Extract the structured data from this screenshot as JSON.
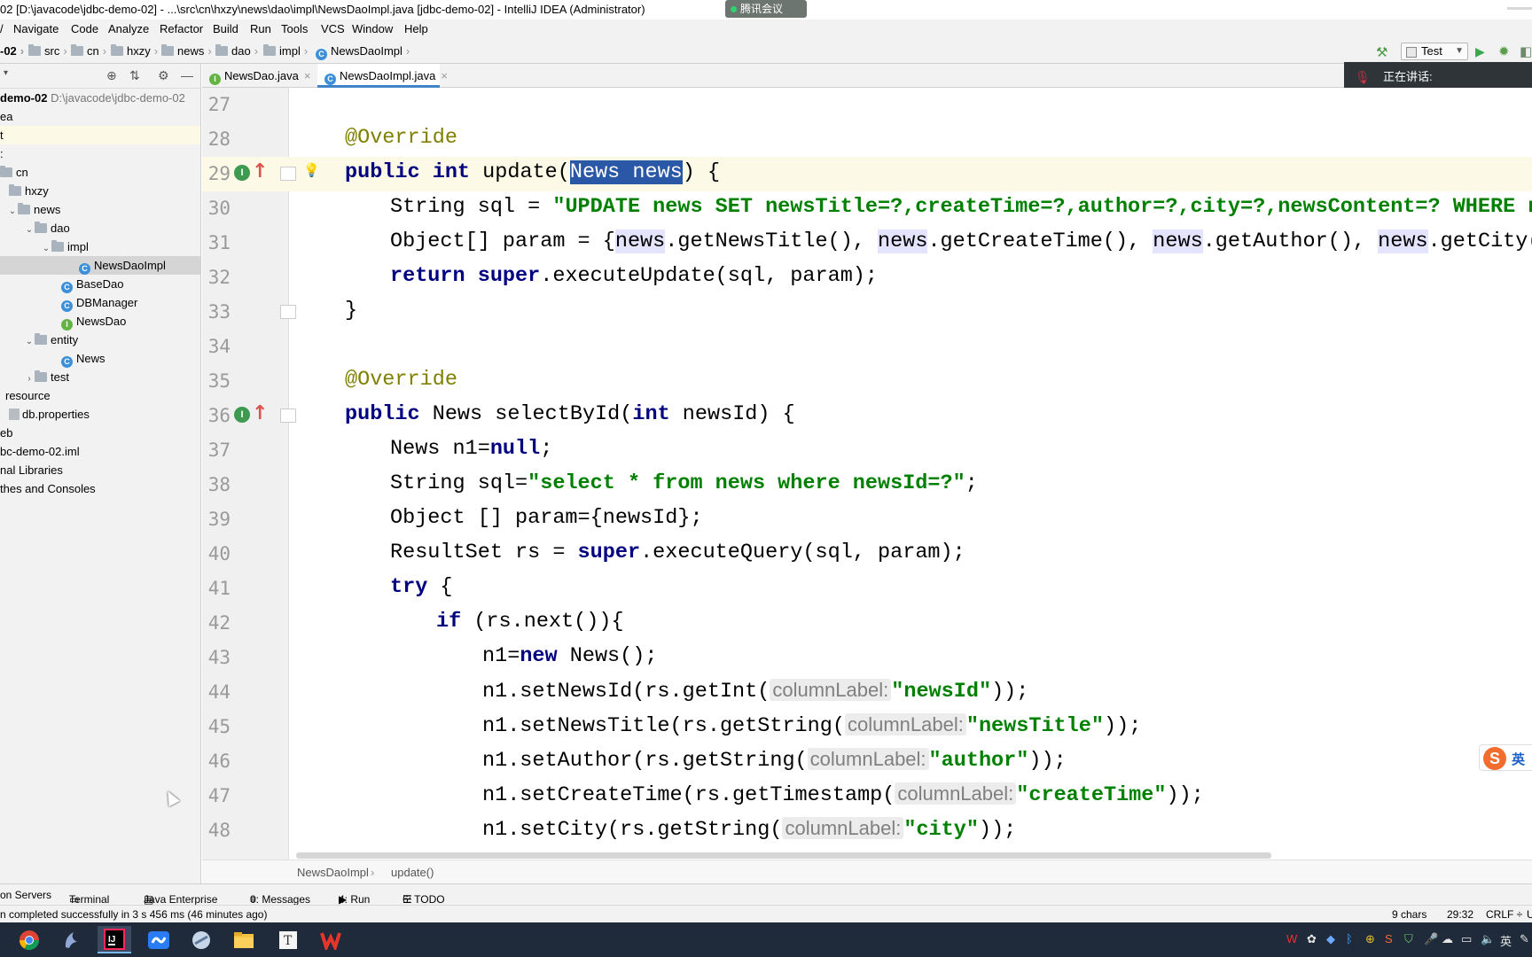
{
  "window": {
    "title": "02 [D:\\javacode\\jdbc-demo-02] - ...\\src\\cn\\hxzy\\news\\dao\\impl\\NewsDaoImpl.java [jdbc-demo-02] - IntelliJ IDEA (Administrator)",
    "meeting_app_label": "腾讯会议"
  },
  "menu": [
    "/",
    "Navigate",
    "Code",
    "Analyze",
    "Refactor",
    "Build",
    "Run",
    "Tools",
    "VCS",
    "Window",
    "Help"
  ],
  "navbar": {
    "crumbs": [
      "-02",
      "src",
      "cn",
      "hxzy",
      "news",
      "dao",
      "impl",
      "NewsDaoImpl"
    ],
    "run_config": "Test"
  },
  "meeting_overlay": {
    "speaking_label": "正在讲话:"
  },
  "project": {
    "rows": [
      {
        "label": "demo-02",
        "path": "D:\\javacode\\jdbc-demo-02"
      },
      {
        "label": "ea"
      },
      {
        "label": "t"
      },
      {
        "label": ":"
      },
      {
        "label": "cn"
      },
      {
        "label": "hxzy"
      },
      {
        "label": "news"
      },
      {
        "label": "dao"
      },
      {
        "label": "impl"
      },
      {
        "label": "NewsDaoImpl"
      },
      {
        "label": "BaseDao"
      },
      {
        "label": "DBManager"
      },
      {
        "label": "NewsDao"
      },
      {
        "label": "entity"
      },
      {
        "label": "News"
      },
      {
        "label": "test"
      },
      {
        "label": "resource"
      },
      {
        "label": "db.properties"
      },
      {
        "label": "eb"
      },
      {
        "label": "bc-demo-02.iml"
      },
      {
        "label": "nal Libraries"
      },
      {
        "label": "thes and Consoles"
      }
    ]
  },
  "tabs": [
    {
      "label": "NewsDao.java",
      "icon": "interface-icon"
    },
    {
      "label": "NewsDaoImpl.java",
      "icon": "class-icon",
      "active": true
    }
  ],
  "editor": {
    "line_numbers": [
      "27",
      "28",
      "29",
      "30",
      "31",
      "32",
      "33",
      "34",
      "35",
      "36",
      "37",
      "38",
      "39",
      "40",
      "41",
      "42",
      "43",
      "44",
      "45",
      "46",
      "47",
      "48"
    ],
    "code": {
      "l28": "@Override",
      "l29a": "public int ",
      "l29b": "update(",
      "l29c": "News news",
      "l29d": ") {",
      "l30a": "String sql = ",
      "l30b": "\"UPDATE news SET newsTitle=?,createTime=?,author=?,city=?,newsContent=? WHERE ne",
      "l31a": "Object[] param = {",
      "l31n": "news",
      "l31b": ".getNewsTitle(), ",
      "l31c": ".getCreateTime(), ",
      "l31d": ".getAuthor(), ",
      "l31e": ".getCity(), ",
      "l32a": "return super",
      "l32b": ".executeUpdate(sql, param);",
      "l33": "}",
      "l35": "@Override",
      "l36a": "public ",
      "l36b": "News selectById(",
      "l36c": "int ",
      "l36d": "newsId) {",
      "l37a": "News n1=",
      "l37b": "null",
      "l37c": ";",
      "l38a": "String sql=",
      "l38b": "\"select * from news where newsId=?\"",
      "l38c": ";",
      "l39": "Object [] param={newsId};",
      "l40a": "ResultSet rs = ",
      "l40b": "super",
      "l40c": ".executeQuery(sql, param);",
      "l41a": "try ",
      "l41b": "{",
      "l42a": "if ",
      "l42b": "(rs.next()){",
      "l43a": "n1=",
      "l43b": "new ",
      "l43c": "News();",
      "l44a": "n1.setNewsId(rs.getInt(",
      "l44h": "columnLabel:",
      "l44s": "\"newsId\"",
      "l44c": "));",
      "l45a": "n1.setNewsTitle(rs.getString(",
      "l45h": "columnLabel:",
      "l45s": "\"newsTitle\"",
      "l45c": "));",
      "l46a": "n1.setAuthor(rs.getString(",
      "l46h": "columnLabel:",
      "l46s": "\"author\"",
      "l46c": "));",
      "l47a": "n1.setCreateTime(rs.getTimestamp(",
      "l47h": "columnLabel:",
      "l47s": "\"createTime\"",
      "l47c": "));",
      "l48a": "n1.setCity(rs.getString(",
      "l48h": "columnLabel:",
      "l48s": "\"city\"",
      "l48c": "));"
    },
    "breadcrumbs": [
      "NewsDaoImpl",
      "update()"
    ]
  },
  "tool_windows": [
    "on Servers",
    "Terminal",
    "Java Enterprise",
    "0: Messages",
    "4: Run",
    "6: TODO"
  ],
  "status": {
    "message": "n completed successfully in 3 s 456 ms (46 minutes ago)",
    "selection": "9 chars",
    "position": "29:32",
    "line_sep": "CRLF ÷",
    "encoding": "U"
  },
  "ime": {
    "logo": "S",
    "mode": "英"
  },
  "taskbar": {
    "tray_ime": "英"
  }
}
